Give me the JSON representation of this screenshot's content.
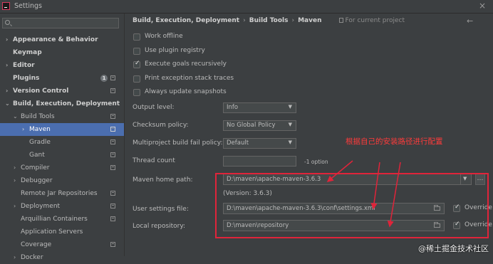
{
  "window": {
    "title": "Settings"
  },
  "search": {
    "placeholder": "",
    "value": ""
  },
  "sidebar": {
    "items": [
      {
        "label": "Appearance & Behavior",
        "arrow": "›",
        "bold": true
      },
      {
        "label": "Keymap",
        "arrow": "",
        "bold": true
      },
      {
        "label": "Editor",
        "arrow": "›",
        "bold": true
      },
      {
        "label": "Plugins",
        "arrow": "",
        "bold": true,
        "badge": "1"
      },
      {
        "label": "Version Control",
        "arrow": "›",
        "bold": true
      },
      {
        "label": "Build, Execution, Deployment",
        "arrow": "⌄",
        "bold": true
      },
      {
        "label": "Build Tools",
        "arrow": "⌄",
        "bold": false
      },
      {
        "label": "Maven",
        "arrow": "›",
        "bold": false,
        "selected": true
      },
      {
        "label": "Gradle",
        "arrow": "",
        "bold": false
      },
      {
        "label": "Gant",
        "arrow": "",
        "bold": false
      },
      {
        "label": "Compiler",
        "arrow": "›",
        "bold": false
      },
      {
        "label": "Debugger",
        "arrow": "›",
        "bold": false
      },
      {
        "label": "Remote Jar Repositories",
        "arrow": "",
        "bold": false
      },
      {
        "label": "Deployment",
        "arrow": "›",
        "bold": false
      },
      {
        "label": "Arquillian Containers",
        "arrow": "",
        "bold": false
      },
      {
        "label": "Application Servers",
        "arrow": "",
        "bold": false
      },
      {
        "label": "Coverage",
        "arrow": "",
        "bold": false
      },
      {
        "label": "Docker",
        "arrow": "›",
        "bold": false
      }
    ]
  },
  "breadcrumb": {
    "parts": [
      "Build, Execution, Deployment",
      "Build Tools",
      "Maven"
    ],
    "separator": "›",
    "project_note": "For current project"
  },
  "checkboxes": [
    {
      "label": "Work offline",
      "checked": false
    },
    {
      "label": "Use plugin registry",
      "checked": false
    },
    {
      "label": "Execute goals recursively",
      "checked": true
    },
    {
      "label": "Print exception stack traces",
      "checked": false
    },
    {
      "label": "Always update snapshots",
      "checked": false
    }
  ],
  "form": {
    "output_level": {
      "label": "Output level:",
      "value": "Info"
    },
    "checksum_policy": {
      "label": "Checksum policy:",
      "value": "No Global Policy"
    },
    "fail_policy": {
      "label": "Multiproject build fail policy:",
      "value": "Default"
    },
    "thread_count": {
      "label": "Thread count",
      "value": "",
      "hint": "-1 option"
    },
    "maven_home": {
      "label": "Maven home path:",
      "value": "D:\\maven\\apache-maven-3.6.3",
      "version": "(Version: 3.6.3)"
    },
    "user_settings": {
      "label": "User settings file:",
      "value": "D:\\maven\\apache-maven-3.6.3\\conf\\settings.xml",
      "override_label": "Override",
      "override_checked": true
    },
    "local_repo": {
      "label": "Local repository:",
      "value": "D:\\maven\\repository",
      "override_label": "Override",
      "override_checked": true
    }
  },
  "annotation": {
    "text": "根据自己的安装路径进行配置",
    "color": "#e0243a"
  },
  "watermark": "@稀土掘金技术社区",
  "colors": {
    "selected": "#4b6eaf",
    "background": "#3c3f41",
    "field": "#45494a"
  }
}
